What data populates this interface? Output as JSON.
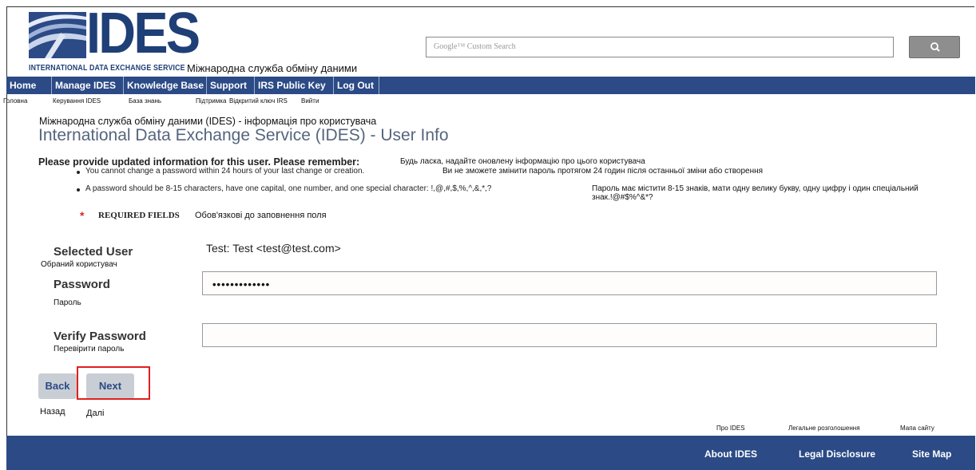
{
  "logo": {
    "text": "IDES",
    "subtitle": "INTERNATIONAL DATA EXCHANGE SERVICE",
    "subtitle_uk": "Міжнародна служба обміну даними"
  },
  "search": {
    "placeholder": "Google™ Custom Search",
    "button_icon": "search-icon"
  },
  "nav": {
    "items": [
      {
        "label": "Home",
        "sub": "Головна"
      },
      {
        "label": "Manage IDES",
        "sub": "Керування IDES"
      },
      {
        "label": "Knowledge Base",
        "sub": "База знань"
      },
      {
        "label": "Support",
        "sub": "Підтримка"
      },
      {
        "label": "IRS Public Key",
        "sub": "Відкритий ключ IRS"
      },
      {
        "label": "Log Out",
        "sub": "Вийти"
      }
    ]
  },
  "page": {
    "title_uk": "Міжнародна служба обміну даними (IDES) - інформація про користувача",
    "title": "International Data Exchange Service (IDES) - User Info",
    "remember": "Please provide updated information for this user. Please remember:",
    "remember_uk": "Будь ласка, надайте оновлену інформацію про цього користувача",
    "bullet1": "You cannot change a password within 24 hours of your last change or creation.",
    "bullet1_uk": "Ви не зможете змінити пароль протягом 24 годин після останньої зміни або створення",
    "bullet2": "A password should be 8-15 characters, have one capital, one number, and one special character: !,@,#,$,%,^,&,*,?",
    "bullet2_uk_line1": "Пароль має містити 8-15 знаків, мати одну велику букву, одну цифру і один спеціальний",
    "bullet2_uk_line2": "знак.!@#$%^&*?",
    "required_star": "*",
    "required": "REQUIRED FIELDS",
    "required_uk": "Обов'язкові до заповнення поля"
  },
  "form": {
    "selected_user_label": "Selected User",
    "selected_user_label_uk": "Обраний користувач",
    "selected_user_value": "Test: Test <test@test.com>",
    "password_label": "Password",
    "password_label_uk": "Пароль",
    "password_value": "•••••••••••••",
    "verify_label": "Verify Password",
    "verify_label_uk": "Перевірити пароль",
    "verify_value": ""
  },
  "buttons": {
    "back": "Back",
    "back_uk": "Назад",
    "next": "Next",
    "next_uk": "Далі"
  },
  "footer": {
    "about": "About IDES",
    "about_uk": "Про IDES",
    "legal": "Legal Disclosure",
    "legal_uk": "Легальне розголошення",
    "sitemap": "Site Map",
    "sitemap_uk": "Мапа сайту"
  },
  "colors": {
    "nav_bg": "#2b4a86",
    "logo": "#1f3f77",
    "highlight": "#e02020"
  }
}
